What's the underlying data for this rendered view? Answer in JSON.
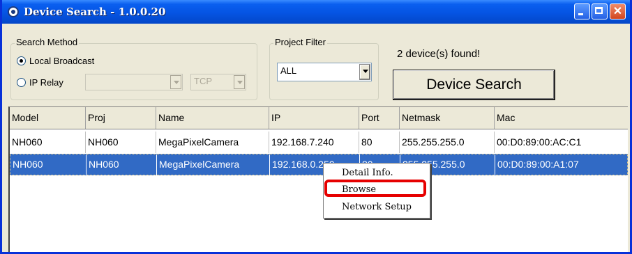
{
  "window": {
    "title": "Device Search - 1.0.0.20"
  },
  "search_method": {
    "legend": "Search Method",
    "local_broadcast_label": "Local Broadcast",
    "local_broadcast_selected": true,
    "ip_relay_label": "IP Relay",
    "ip_relay_value": "",
    "protocol_value": "TCP"
  },
  "project_filter": {
    "legend": "Project Filter",
    "value": "ALL"
  },
  "status": {
    "found_text": "2 device(s) found!"
  },
  "toolbar": {
    "search_button": "Device Search"
  },
  "table": {
    "columns": [
      "Model",
      "Proj",
      "Name",
      "IP",
      "Port",
      "Netmask",
      "Mac"
    ],
    "rows": [
      [
        "NH060",
        "NH060",
        "MegaPixelCamera",
        "192.168.7.240",
        "80",
        "255.255.255.0",
        "00:D0:89:00:AC:C1"
      ],
      [
        "NH060",
        "NH060",
        "MegaPixelCamera",
        "192.168.0.250",
        "80",
        "255.255.255.0",
        "00:D0:89:00:A1:07"
      ]
    ],
    "selected_row": 1
  },
  "context_menu": {
    "items": [
      "Detail Info.",
      "Browse",
      "Network Setup"
    ],
    "highlighted": "Browse"
  },
  "colors": {
    "title_bar": "#0554E3",
    "selection": "#316AC5",
    "highlight_box": "#E60000"
  }
}
